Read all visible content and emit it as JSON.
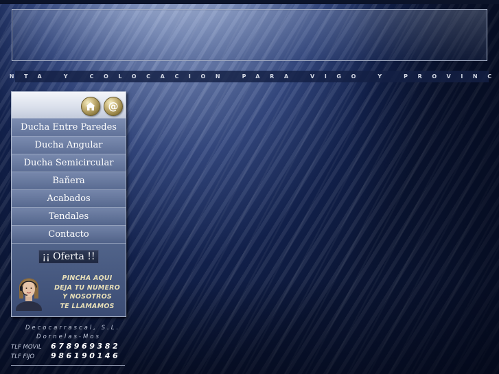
{
  "tagline": "VENTA Y COLOCACION PARA VIGO Y PROVINCIA",
  "icons": {
    "home": "home-icon",
    "email": "at-sign-icon",
    "email_glyph": "@",
    "home_glyph": "⌂"
  },
  "menu": {
    "items": [
      {
        "label": "Ducha Entre Paredes"
      },
      {
        "label": "Ducha Angular"
      },
      {
        "label": "Ducha Semicircular"
      },
      {
        "label": "Bañera"
      },
      {
        "label": "Acabados"
      },
      {
        "label": "Tendales"
      },
      {
        "label": "Contacto"
      }
    ],
    "offer_label": "¡¡ Oferta !!"
  },
  "callback": {
    "line1": "PINCHA AQUI",
    "line2": "DEJA TU NUMERO",
    "line3": "Y NOSOTROS",
    "line4": "TE LLAMAMOS"
  },
  "footer": {
    "company": "Decocarrascal, S.L.",
    "address": "Dornelas-Mos",
    "mobile_label": "TLF MOVIL",
    "mobile_number": "678969382",
    "landline_label": "TLF FIJO",
    "landline_number": "986190146"
  },
  "colors": {
    "background": "#12214c",
    "accent_gold": "#c9b57a",
    "callback_text": "#e8dfb8",
    "tagline_bar": "#14204a"
  }
}
